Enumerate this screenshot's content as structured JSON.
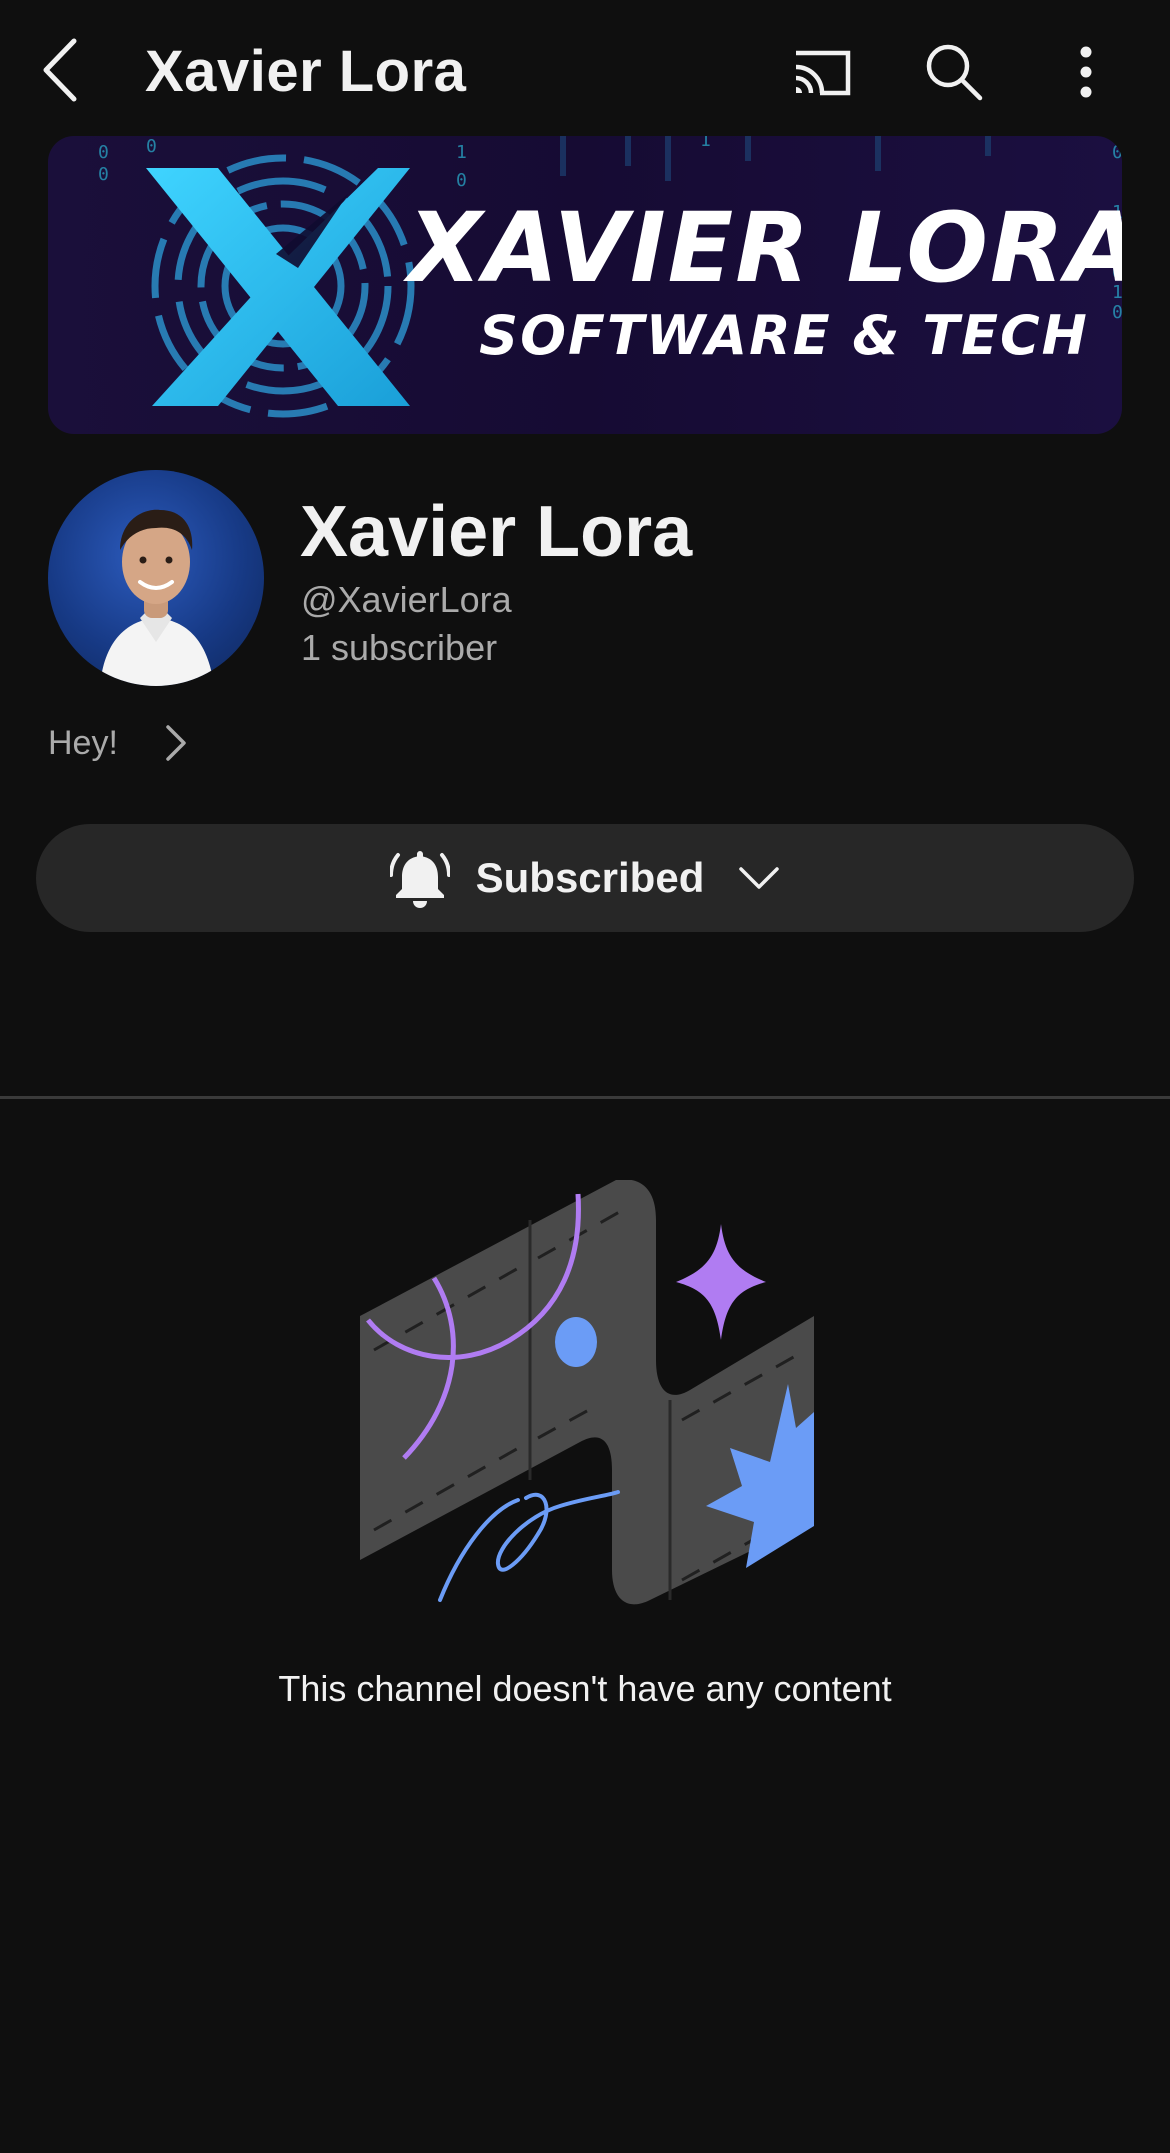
{
  "topbar": {
    "title": "Xavier Lora",
    "icons": [
      "back-icon",
      "cast-icon",
      "search-icon",
      "more-vert-icon"
    ]
  },
  "banner": {
    "title": "XAVIER LORA",
    "subtitle": "SOFTWARE & TECH",
    "accent_color": "#29c3f2",
    "background_color": "#170d38"
  },
  "channel": {
    "name": "Xavier Lora",
    "handle": "@XavierLora",
    "subscribers": "1 subscriber",
    "description": "Hey!"
  },
  "subscribe": {
    "label": "Subscribed",
    "icons": [
      "bell-icon",
      "chevron-down-icon"
    ]
  },
  "empty_state": {
    "message": "This channel doesn't have any content",
    "colors": {
      "purple": "#b07cf2",
      "blue": "#6b9cf6",
      "slab": "#4a4a4a"
    }
  }
}
